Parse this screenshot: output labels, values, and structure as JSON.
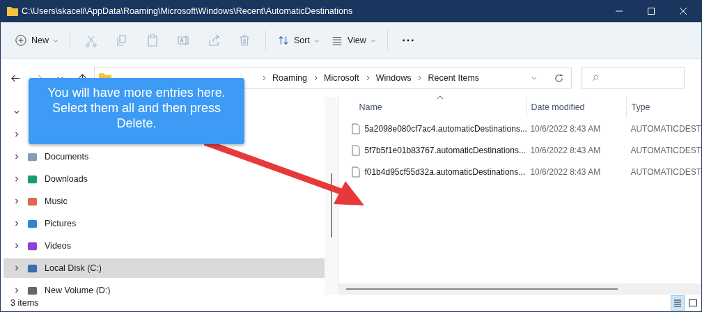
{
  "window": {
    "title": "C:\\Users\\skaceli\\AppData\\Roaming\\Microsoft\\Windows\\Recent\\AutomaticDestinations"
  },
  "toolbar": {
    "new_label": "New",
    "tools": [
      {
        "kind": "cut",
        "disabled": true
      },
      {
        "kind": "copy",
        "disabled": true
      },
      {
        "kind": "paste",
        "disabled": true
      },
      {
        "kind": "rename",
        "disabled": true
      },
      {
        "kind": "share",
        "disabled": true
      },
      {
        "kind": "delete",
        "disabled": true
      }
    ],
    "sort_label": "Sort",
    "view_label": "View"
  },
  "address": {
    "crumbs": [
      "Roaming",
      "Microsoft",
      "Windows",
      "Recent Items"
    ]
  },
  "sidebar": {
    "items": [
      {
        "kind": "hidden",
        "expanded": true
      },
      {
        "kind": "hidden",
        "expanded": false
      },
      {
        "kind": "documents",
        "label": "Documents",
        "expanded": false,
        "selected": false
      },
      {
        "kind": "downloads",
        "label": "Downloads",
        "expanded": false,
        "selected": false
      },
      {
        "kind": "music",
        "label": "Music",
        "expanded": false,
        "selected": false
      },
      {
        "kind": "pictures",
        "label": "Pictures",
        "expanded": false,
        "selected": false
      },
      {
        "kind": "videos",
        "label": "Videos",
        "expanded": false,
        "selected": false
      },
      {
        "kind": "disk",
        "label": "Local Disk (C:)",
        "expanded": false,
        "selected": true
      },
      {
        "kind": "volume",
        "label": "New Volume (D:)",
        "expanded": false,
        "selected": false
      }
    ]
  },
  "files": {
    "columns": [
      "Name",
      "Date modified",
      "Type"
    ],
    "rows": [
      {
        "name": "5a2098e080cf7ac4.automaticDestinations...",
        "date": "10/6/2022 8:43 AM",
        "type": "AUTOMATICDEST"
      },
      {
        "name": "5f7b5f1e01b83767.automaticDestinations...",
        "date": "10/6/2022 8:43 AM",
        "type": "AUTOMATICDEST"
      },
      {
        "name": "f01b4d95cf55d32a.automaticDestinations...",
        "date": "10/6/2022 8:43 AM",
        "type": "AUTOMATICDEST"
      }
    ]
  },
  "status_bar": {
    "count": "3 items",
    "views": [
      {
        "kind": "details",
        "selected": true
      },
      {
        "kind": "tiles",
        "selected": false
      }
    ]
  },
  "callout": {
    "text": "You will have more entries here. Select them all and then press Delete."
  }
}
